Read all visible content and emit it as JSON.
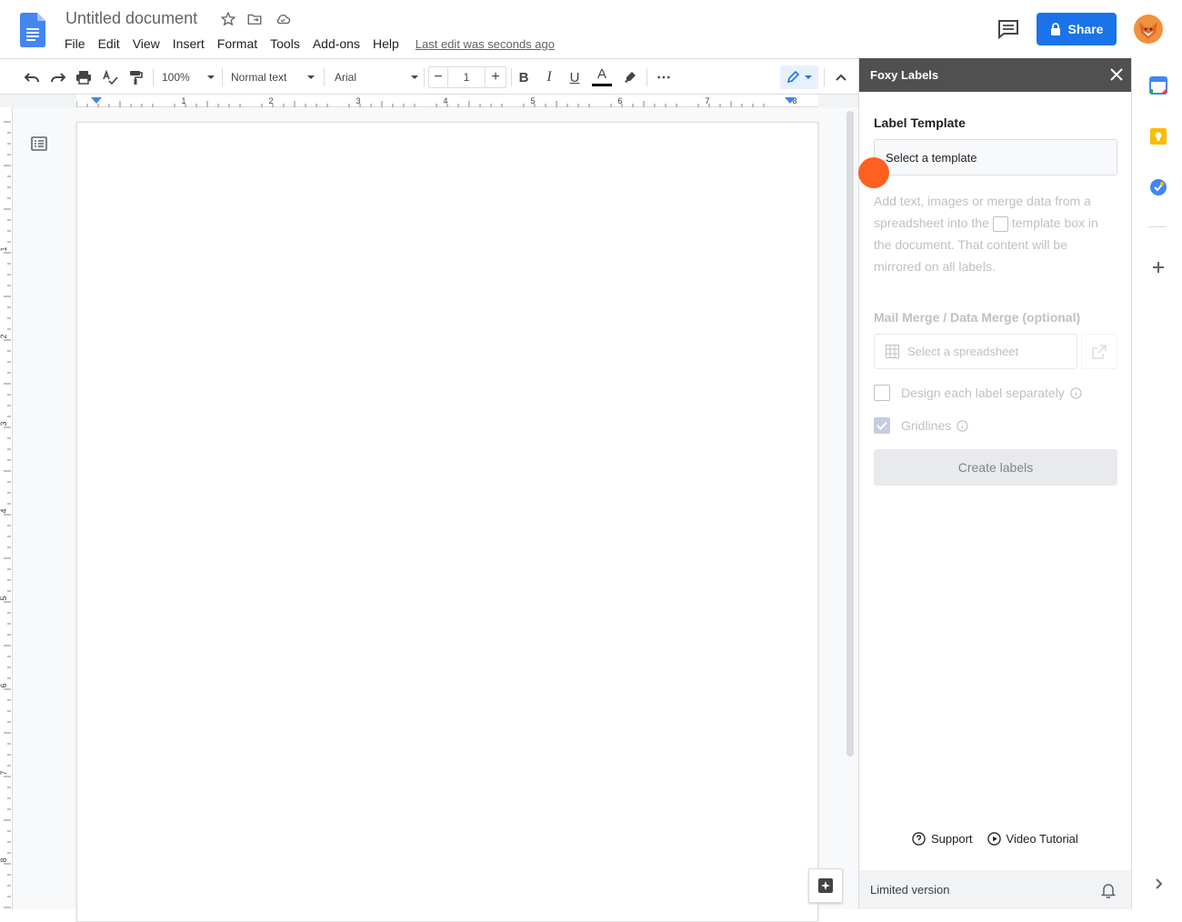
{
  "header": {
    "doc_title": "Untitled document",
    "menu": [
      "File",
      "Edit",
      "View",
      "Insert",
      "Format",
      "Tools",
      "Add-ons",
      "Help"
    ],
    "last_edit": "Last edit was seconds ago",
    "share_label": "Share"
  },
  "toolbar": {
    "zoom": "100%",
    "style": "Normal text",
    "font": "Arial",
    "font_size": "1",
    "bold": "B",
    "italic": "I",
    "underline": "U",
    "text_color": "A",
    "more": "⋯"
  },
  "ruler": {
    "h_ticks": [
      "1",
      "2",
      "3",
      "4",
      "5",
      "6",
      "7",
      "8"
    ],
    "v_ticks": [
      "1",
      "2",
      "3",
      "4",
      "5",
      "6",
      "7",
      "8"
    ]
  },
  "side_panel": {
    "title": "Foxy Labels",
    "label_template_title": "Label Template",
    "template_select": "Select a template",
    "help_text_1": "Add text, images or merge data from a spreadsheet into the",
    "help_text_2": "template box in the document. That content will be mirrored on all labels.",
    "merge_title": "Mail Merge / Data Merge (optional)",
    "sheet_select": "Select a spreadsheet",
    "design_each": "Design each label separately",
    "gridlines": "Gridlines",
    "create_labels": "Create labels",
    "support": "Support",
    "video_tutorial": "Video Tutorial",
    "footer": "Limited version"
  },
  "colors": {
    "accent": "#1a73e8",
    "panel_header": "#505050",
    "cursor": "#ff5f1f"
  }
}
